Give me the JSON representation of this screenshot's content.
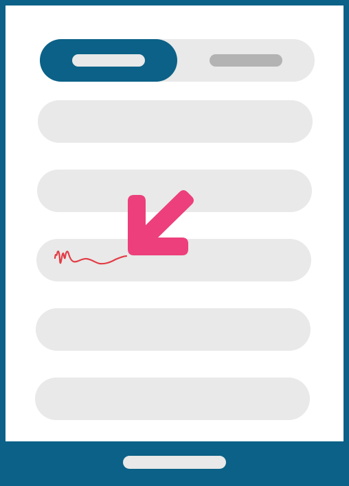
{
  "app": {
    "accent_color": "#0b6187",
    "field_color": "#e8e9e8",
    "inactive_tab_color": "#b3b3b3"
  },
  "tabs": [
    {
      "label": "",
      "selected": true
    },
    {
      "label": "",
      "selected": false
    }
  ],
  "fields": [
    {
      "value": "",
      "placeholder": ""
    },
    {
      "value": "",
      "placeholder": ""
    },
    {
      "value": "",
      "placeholder": ""
    },
    {
      "value": "",
      "placeholder": ""
    },
    {
      "value": "",
      "placeholder": ""
    }
  ],
  "annotations": {
    "pointer_arrow": {
      "icon": "down-left-arrow-icon",
      "color": "#ec3f7b"
    },
    "signature": {
      "icon": "signature-scribble-icon",
      "color": "#e33b45"
    }
  }
}
